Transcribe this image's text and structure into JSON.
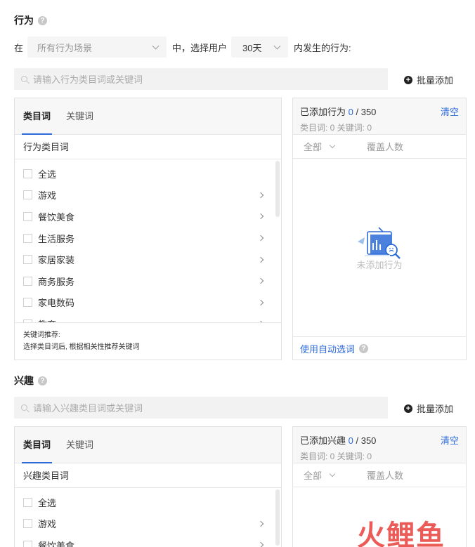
{
  "behavior": {
    "title": "行为",
    "help": "?",
    "condition": {
      "prefix": "在",
      "scene_value": "所有行为场景",
      "middle": "中，选择用户",
      "days_value": "30天",
      "suffix": "内发生的行为:"
    },
    "search_placeholder": "请输入行为类目词或关键词",
    "batch_add": "批量添加",
    "tabs": [
      "类目词",
      "关键词"
    ],
    "breadcrumb": "行为类目词",
    "items": [
      "全选",
      "游戏",
      "餐饮美食",
      "生活服务",
      "家居家装",
      "商务服务",
      "家电数码",
      "教育"
    ],
    "recommendation": {
      "title": "关键词推荐:",
      "text": "选择类目词后, 根据相关性推荐关键词"
    },
    "right": {
      "title_prefix": "已添加行为",
      "count": "0",
      "total": "/ 350",
      "clear": "清空",
      "sub": "类目词: 0    关键词: 0",
      "col_all": "全部",
      "col_coverage": "覆盖人数",
      "empty_text": "未添加行为",
      "auto_select": "使用自动选词"
    }
  },
  "interest": {
    "title": "兴趣",
    "help": "?",
    "search_placeholder": "请输入兴趣类目词或关键词",
    "batch_add": "批量添加",
    "tabs": [
      "类目词",
      "关键词"
    ],
    "breadcrumb": "兴趣类目词",
    "items": [
      "全选",
      "游戏",
      "餐饮美食"
    ],
    "right": {
      "title_prefix": "已添加兴趣",
      "count": "0",
      "total": "/ 350",
      "clear": "清空",
      "sub": "类目词: 0    关键词: 0",
      "col_all": "全部",
      "col_coverage": "覆盖人数"
    }
  },
  "watermark": "火鲤鱼",
  "colors": {
    "accent": "#2d6bd8",
    "watermark": "#e8403c"
  },
  "icons": [
    "help-icon",
    "search-icon",
    "plus-circle-icon",
    "chevron-down-icon",
    "chevron-right-icon",
    "empty-chart-icon"
  ]
}
